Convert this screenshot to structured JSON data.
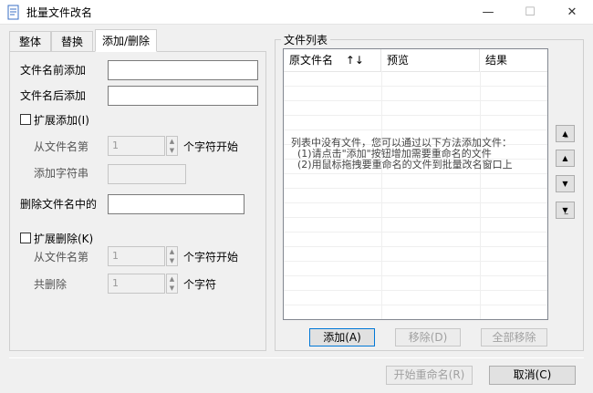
{
  "window": {
    "title": "批量文件改名",
    "minimize": "—",
    "maximize": "☐",
    "close": "✕"
  },
  "tabs": [
    {
      "label": "整体"
    },
    {
      "label": "替换"
    },
    {
      "label": "添加/删除"
    }
  ],
  "form": {
    "prefix_label": "文件名前添加",
    "prefix_value": "",
    "suffix_label": "文件名后添加",
    "suffix_value": "",
    "extend_add_label": "扩展添加(I)",
    "from_pos_label": "从文件名第",
    "from_pos_value": "1",
    "char_start_label": "个字符开始",
    "add_string_label": "添加字符串",
    "add_string_value": "",
    "delete_in_name_label": "删除文件名中的",
    "delete_in_name_value": "",
    "extend_delete_label": "扩展删除(K)",
    "del_from_label": "从文件名第",
    "del_from_value": "1",
    "del_char_start_label": "个字符开始",
    "total_delete_label": "共删除",
    "total_delete_value": "1",
    "chars_label": "个字符"
  },
  "file_list": {
    "group_title": "文件列表",
    "columns": [
      "原文件名",
      "预览",
      "结果"
    ],
    "sort_icon": "↑↓",
    "empty_line1": "列表中没有文件，您可以通过以下方法添加文件：",
    "empty_line2": "  (1)请点击\"添加\"按钮增加需要重命名的文件",
    "empty_line3": "  (2)用鼠标拖拽要重命名的文件到批量改名窗口上",
    "add_button": "添加(A)",
    "remove_button": "移除(D)",
    "remove_all_button": "全部移除"
  },
  "side_buttons": [
    "move-top-icon",
    "move-up-icon",
    "move-down-icon",
    "move-bottom-icon"
  ],
  "footer": {
    "start_button": "开始重命名(R)",
    "cancel_button": "取消(C)"
  }
}
